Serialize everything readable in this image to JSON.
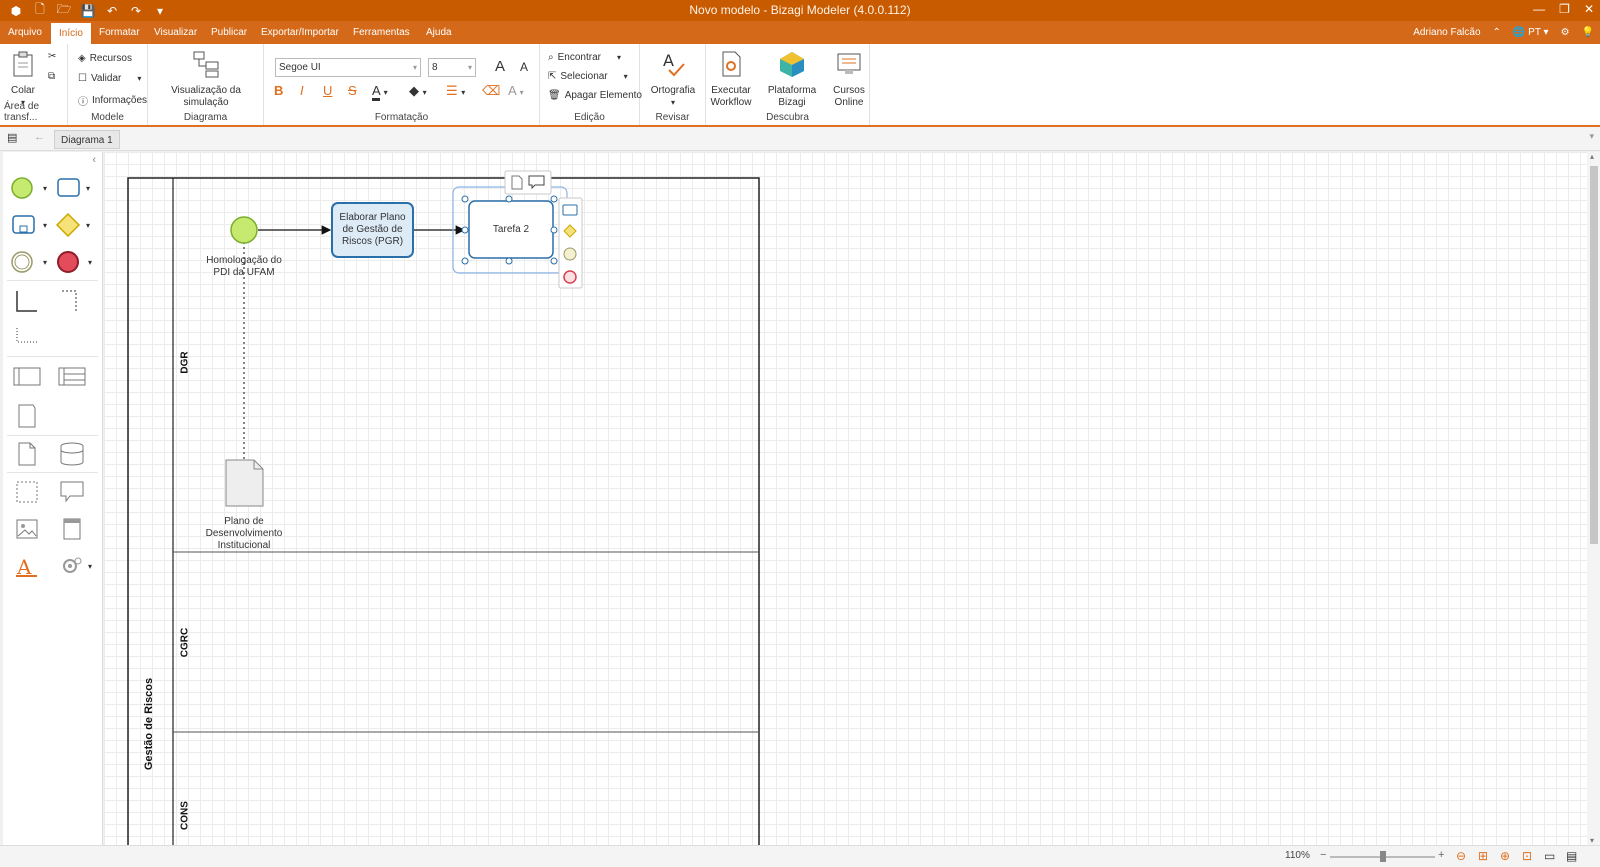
{
  "window": {
    "title": "Novo modelo - Bizagi Modeler (4.0.0.112)"
  },
  "menu": {
    "tabs": [
      "Arquivo",
      "Início",
      "Formatar",
      "Visualizar",
      "Publicar",
      "Exportar/Importar",
      "Ferramentas",
      "Ajuda"
    ],
    "active": "Início",
    "user": "Adriano Falcão",
    "language": "PT"
  },
  "ribbon": {
    "clipboard": {
      "paste": "Colar",
      "group": "Área de transf..."
    },
    "model": {
      "resources": "Recursos",
      "validate": "Validar",
      "info": "Informações",
      "group": "Modele"
    },
    "diagram": {
      "simulation": "Visualização da simulação",
      "group": "Diagrama"
    },
    "format": {
      "font": "Segoe UI",
      "size": "8",
      "group": "Formatação",
      "bold": "B",
      "italic": "I",
      "underline": "U",
      "strike": "S",
      "grow": "A",
      "shrink": "A"
    },
    "edit": {
      "find": "Encontrar",
      "select": "Selecionar",
      "delete": "Apagar Elemento",
      "group": "Edição"
    },
    "review": {
      "spelling": "Ortografia",
      "group": "Revisar"
    },
    "discover": {
      "workflow_l1": "Executar",
      "workflow_l2": "Workflow",
      "platform": "Plataforma Bizagi",
      "courses_l1": "Cursos",
      "courses_l2": "Online",
      "group": "Descubra"
    }
  },
  "tabs": {
    "diagram": "Diagrama 1"
  },
  "diagram": {
    "pool": "Gestão de Riscos",
    "lanes": [
      "DGR",
      "CGRC",
      "CONS"
    ],
    "start_event_l1": "Homologação do",
    "start_event_l2": "PDI da UFAM",
    "task1_l1": "Elaborar Plano",
    "task1_l2": "de Gestão de",
    "task1_l3": "Riscos (PGR)",
    "task2": "Tarefa 2",
    "doc_l1": "Plano de",
    "doc_l2": "Desenvolvimento",
    "doc_l3": "Institucional"
  },
  "status": {
    "zoom": "110%"
  },
  "colors": {
    "accent": "#d4691a",
    "titlebar": "#c85b00",
    "task_stroke": "#2a6fa8",
    "start_fill": "#c6ea6f"
  }
}
